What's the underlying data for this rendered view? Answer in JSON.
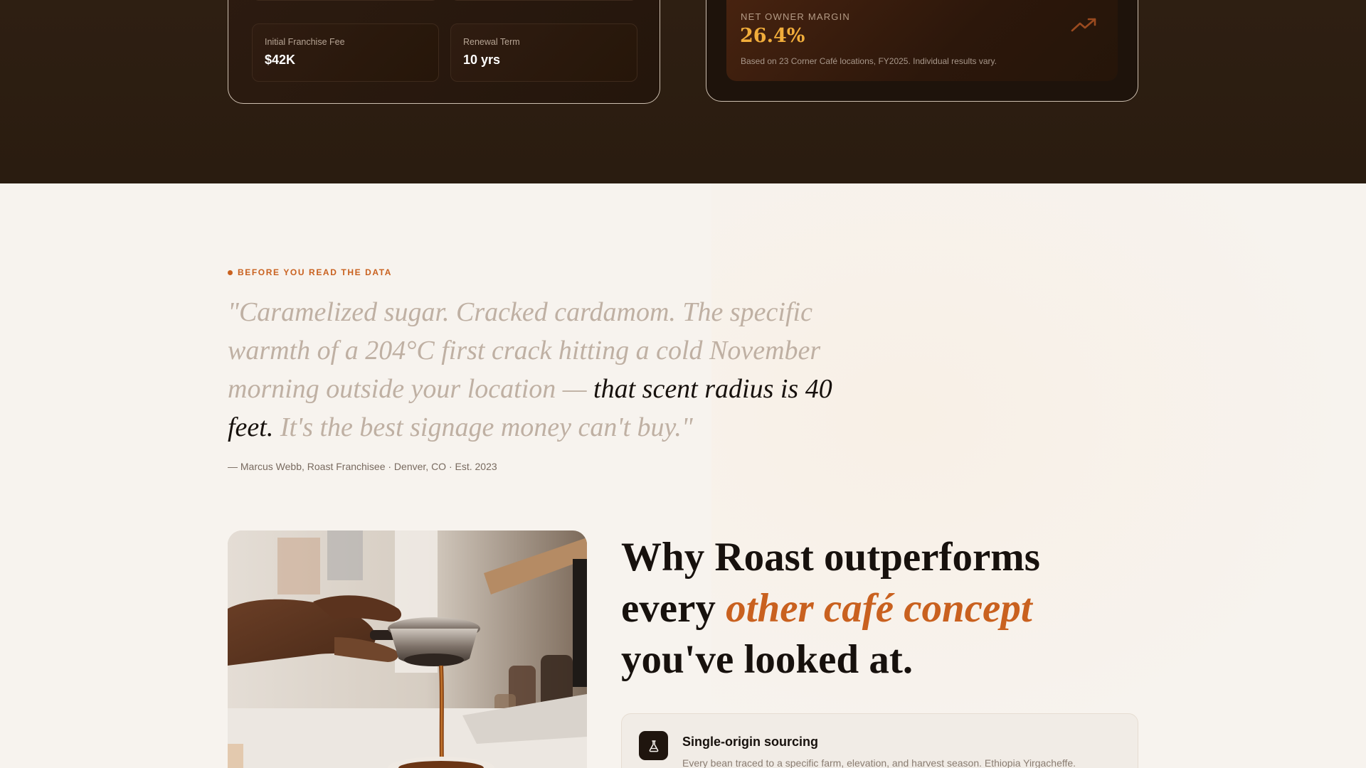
{
  "franchise_terms": {
    "fee_label": "Initial Franchise Fee",
    "fee_value": "$42K",
    "renewal_label": "Renewal Term",
    "renewal_value": "10 yrs"
  },
  "margin": {
    "label": "NET OWNER MARGIN",
    "value": "26.4%",
    "note": "Based on 23 Corner Café locations, FY2025. Individual results vary.",
    "icon": "trending-up-icon"
  },
  "testimonial": {
    "eyebrow": "BEFORE YOU READ THE DATA",
    "quote_pre": "\"Caramelized sugar. Cracked cardamom. The specific warmth of a 204°C first crack hitting a cold November morning outside your location — ",
    "quote_highlight": "that scent radius is 40 feet.",
    "quote_post": " It's the best signage money can't buy.\"",
    "attribution": "— Marcus Webb, Roast Franchisee · Denver, CO · Est. 2023"
  },
  "why": {
    "title_pre": "Why Roast outperforms every ",
    "title_accent": "other café concept",
    "title_post": " you've looked at."
  },
  "features": [
    {
      "icon": "flask-icon",
      "title": "Single-origin sourcing",
      "description": "Every bean traced to a specific farm, elevation, and harvest season. Ethiopia Yirgacheffe."
    }
  ],
  "colors": {
    "accent": "#c9611f",
    "gold": "#f1ad3b",
    "dark": "#2a1c10",
    "cream": "#f7f3ee"
  }
}
